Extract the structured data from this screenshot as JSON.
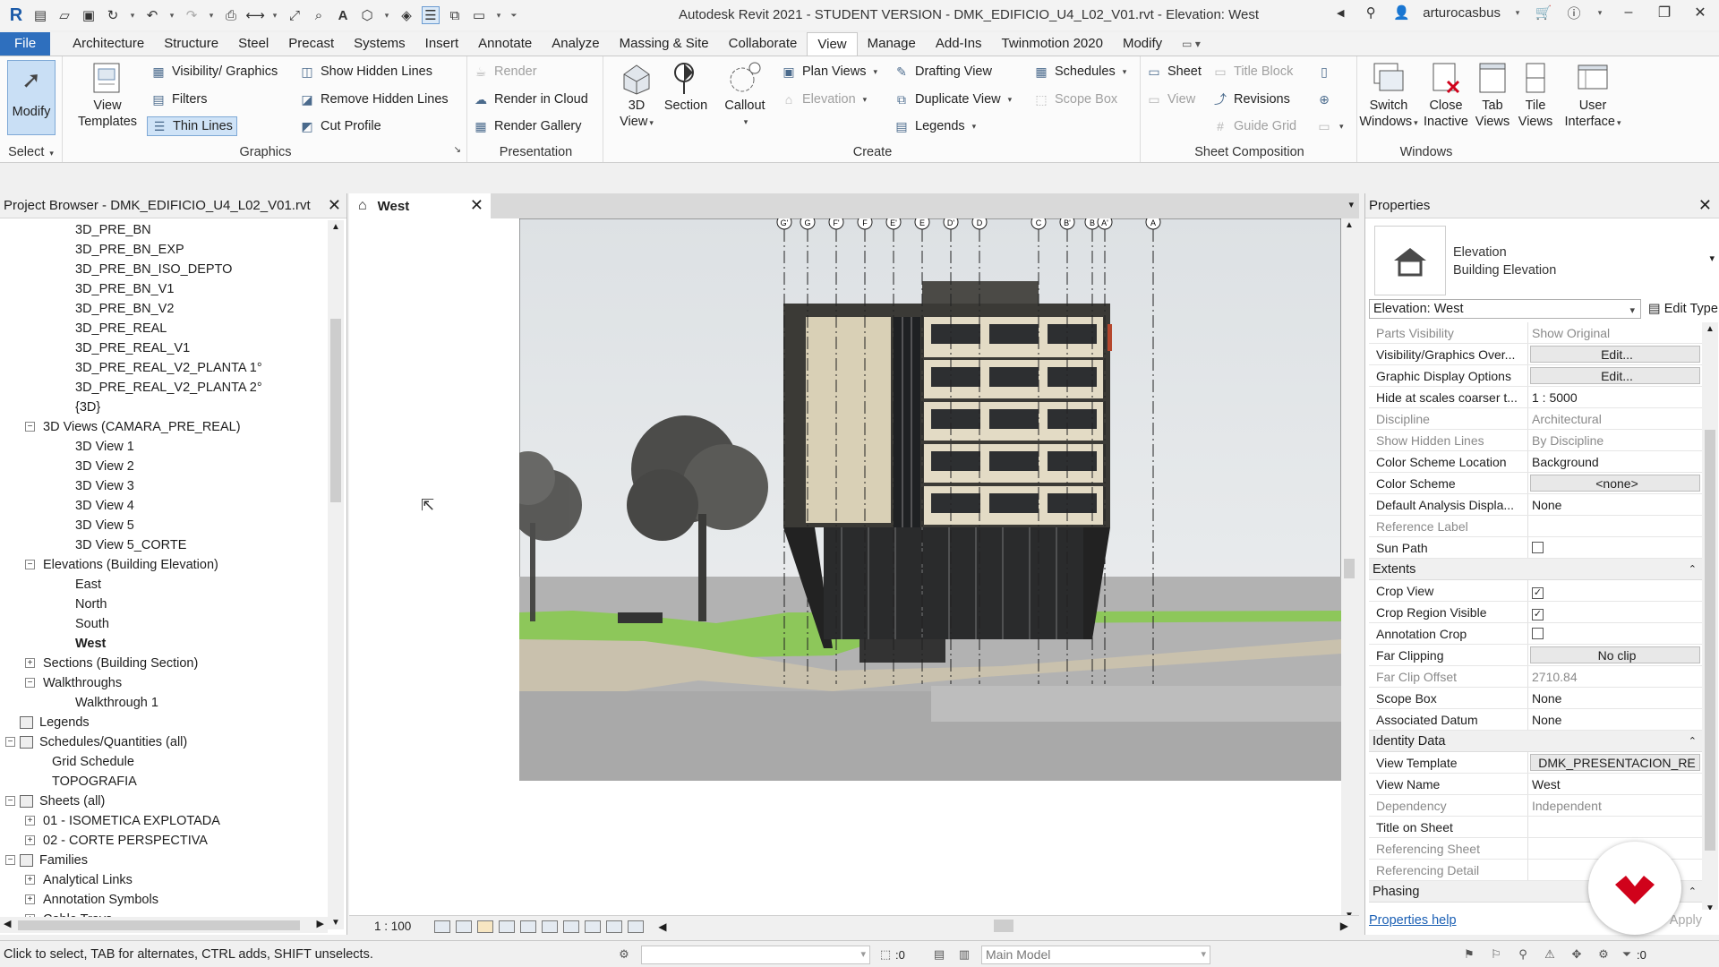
{
  "app": {
    "title": "Autodesk Revit 2021 - STUDENT VERSION - DMK_EDIFICIO_U4_L02_V01.rvt - Elevation: West",
    "user": "arturocasbus"
  },
  "tabs": [
    "File",
    "Architecture",
    "Structure",
    "Steel",
    "Precast",
    "Systems",
    "Insert",
    "Annotate",
    "Analyze",
    "Massing & Site",
    "Collaborate",
    "View",
    "Manage",
    "Add-Ins",
    "Twinmotion 2020",
    "Modify"
  ],
  "active_tab": "View",
  "ribbon": {
    "select": {
      "modify": "Modify",
      "label": "Select"
    },
    "graphics": {
      "label": "Graphics",
      "view_templates": [
        "View",
        "Templates"
      ],
      "visibility": "Visibility/ Graphics",
      "filters": "Filters",
      "thin_lines": "Thin Lines",
      "show_hidden": "Show Hidden Lines",
      "remove_hidden": "Remove Hidden Lines",
      "cut_profile": "Cut Profile"
    },
    "presentation": {
      "label": "Presentation",
      "render": "Render",
      "render_cloud": "Render in Cloud",
      "render_gallery": "Render Gallery"
    },
    "create": {
      "label": "Create",
      "view3d": [
        "3D",
        "View"
      ],
      "section": "Section",
      "callout": "Callout",
      "plan_views": "Plan Views",
      "elevation": "Elevation",
      "drafting_view": "Drafting View",
      "duplicate_view": "Duplicate View",
      "legends": "Legends",
      "schedules": "Schedules",
      "scope_box": "Scope Box"
    },
    "sheet_composition": {
      "label": "Sheet Composition",
      "sheet": "Sheet",
      "view": "View",
      "title_block": "Title Block",
      "revisions": "Revisions",
      "guide_grid": "Guide Grid"
    },
    "windows": {
      "label": "Windows",
      "switch": [
        "Switch",
        "Windows"
      ],
      "close_inactive": [
        "Close",
        "Inactive"
      ],
      "tab_views": [
        "Tab",
        "Views"
      ],
      "tile_views": [
        "Tile",
        "Views"
      ],
      "user_interface": [
        "User",
        "Interface"
      ]
    }
  },
  "browser": {
    "title": "Project Browser - DMK_EDIFICIO_U4_L02_V01.rvt",
    "items": [
      {
        "label": "3D_PRE_BN",
        "level": 3
      },
      {
        "label": "3D_PRE_BN_EXP",
        "level": 3
      },
      {
        "label": "3D_PRE_BN_ISO_DEPTO",
        "level": 3
      },
      {
        "label": "3D_PRE_BN_V1",
        "level": 3
      },
      {
        "label": "3D_PRE_BN_V2",
        "level": 3
      },
      {
        "label": "3D_PRE_REAL",
        "level": 3
      },
      {
        "label": "3D_PRE_REAL_V1",
        "level": 3
      },
      {
        "label": "3D_PRE_REAL_V2_PLANTA 1°",
        "level": 3
      },
      {
        "label": "3D_PRE_REAL_V2_PLANTA 2°",
        "level": 3
      },
      {
        "label": "{3D}",
        "level": 3
      },
      {
        "label": "3D Views (CAMARA_PRE_REAL)",
        "level": 2,
        "exp": "−"
      },
      {
        "label": "3D View 1",
        "level": 3
      },
      {
        "label": "3D View 2",
        "level": 3
      },
      {
        "label": "3D View 3",
        "level": 3
      },
      {
        "label": "3D View 4",
        "level": 3
      },
      {
        "label": "3D View 5",
        "level": 3
      },
      {
        "label": "3D View 5_CORTE",
        "level": 3
      },
      {
        "label": "Elevations (Building Elevation)",
        "level": 2,
        "exp": "−"
      },
      {
        "label": "East",
        "level": 3
      },
      {
        "label": "North",
        "level": 3
      },
      {
        "label": "South",
        "level": 3
      },
      {
        "label": "West",
        "level": 3,
        "bold": true
      },
      {
        "label": "Sections (Building Section)",
        "level": 2,
        "exp": "+"
      },
      {
        "label": "Walkthroughs",
        "level": 2,
        "exp": "−"
      },
      {
        "label": "Walkthrough 1",
        "level": 3
      },
      {
        "label": "Legends",
        "level": 1,
        "icon": true
      },
      {
        "label": "Schedules/Quantities (all)",
        "level": 1,
        "exp": "−",
        "icon": true
      },
      {
        "label": "Grid Schedule",
        "level": 2
      },
      {
        "label": "TOPOGRAFIA",
        "level": 2
      },
      {
        "label": "Sheets (all)",
        "level": 1,
        "exp": "−",
        "icon": true
      },
      {
        "label": "01 - ISOMETICA EXPLOTADA",
        "level": 2,
        "exp": "+"
      },
      {
        "label": "02 - CORTE PERSPECTIVA",
        "level": 2,
        "exp": "+"
      },
      {
        "label": "Families",
        "level": 1,
        "exp": "−",
        "icon": true
      },
      {
        "label": "Analytical Links",
        "level": 2,
        "exp": "+"
      },
      {
        "label": "Annotation Symbols",
        "level": 2,
        "exp": "+"
      },
      {
        "label": "Cable Trays",
        "level": 2,
        "exp": "+"
      }
    ]
  },
  "view": {
    "tab_title": "West",
    "scale": "1 : 100",
    "grid_labels": [
      "G'",
      "G",
      "F'",
      "F",
      "E'",
      "E",
      "D'",
      "D",
      "C",
      "B'",
      "B",
      "A'",
      "A"
    ]
  },
  "properties": {
    "title": "Properties",
    "type_name": "Elevation",
    "type_sub": "Building Elevation",
    "instance": "Elevation: West",
    "edit_type": "Edit Type",
    "rows": [
      {
        "label": "Parts Visibility",
        "value": "Show Original",
        "ro": true
      },
      {
        "label": "Visibility/Graphics Over...",
        "value": "Edit...",
        "btn": true
      },
      {
        "label": "Graphic Display Options",
        "value": "Edit...",
        "btn": true
      },
      {
        "label": "Hide at scales coarser t...",
        "value": "1 : 5000"
      },
      {
        "label": "Discipline",
        "value": "Architectural",
        "ro": true
      },
      {
        "label": "Show Hidden Lines",
        "value": "By Discipline",
        "ro": true
      },
      {
        "label": "Color Scheme Location",
        "value": "Background"
      },
      {
        "label": "Color Scheme",
        "value": "<none>",
        "btn": true
      },
      {
        "label": "Default Analysis Displa...",
        "value": "None"
      },
      {
        "label": "Reference Label",
        "value": "",
        "ro": true
      },
      {
        "label": "Sun Path",
        "value": "",
        "check": false
      },
      {
        "group": "Extents"
      },
      {
        "label": "Crop View",
        "value": "",
        "check": true
      },
      {
        "label": "Crop Region Visible",
        "value": "",
        "check": true
      },
      {
        "label": "Annotation Crop",
        "value": "",
        "check": false
      },
      {
        "label": "Far Clipping",
        "value": "No clip",
        "btn": true
      },
      {
        "label": "Far Clip Offset",
        "value": "2710.84",
        "ro": true
      },
      {
        "label": "Scope Box",
        "value": "None"
      },
      {
        "label": "Associated Datum",
        "value": "None"
      },
      {
        "group": "Identity Data"
      },
      {
        "label": "View Template",
        "value": "DMK_PRESENTACION_RE",
        "btn": true
      },
      {
        "label": "View Name",
        "value": "West"
      },
      {
        "label": "Dependency",
        "value": "Independent",
        "ro": true
      },
      {
        "label": "Title on Sheet",
        "value": ""
      },
      {
        "label": "Referencing Sheet",
        "value": "",
        "ro": true
      },
      {
        "label": "Referencing Detail",
        "value": "",
        "ro": true
      },
      {
        "group": "Phasing"
      }
    ],
    "help": "Properties help",
    "apply": "Apply"
  },
  "status": {
    "text": "Click to select, TAB for alternates, CTRL adds, SHIFT unselects.",
    "zero1": ":0",
    "model": "Main Model",
    "zero2": ":0"
  },
  "colors": {
    "file_tab": "#2e6fbe",
    "logo_red": "#d0021b",
    "sky": "#e6e9eb",
    "grass": "#8dc75a"
  }
}
